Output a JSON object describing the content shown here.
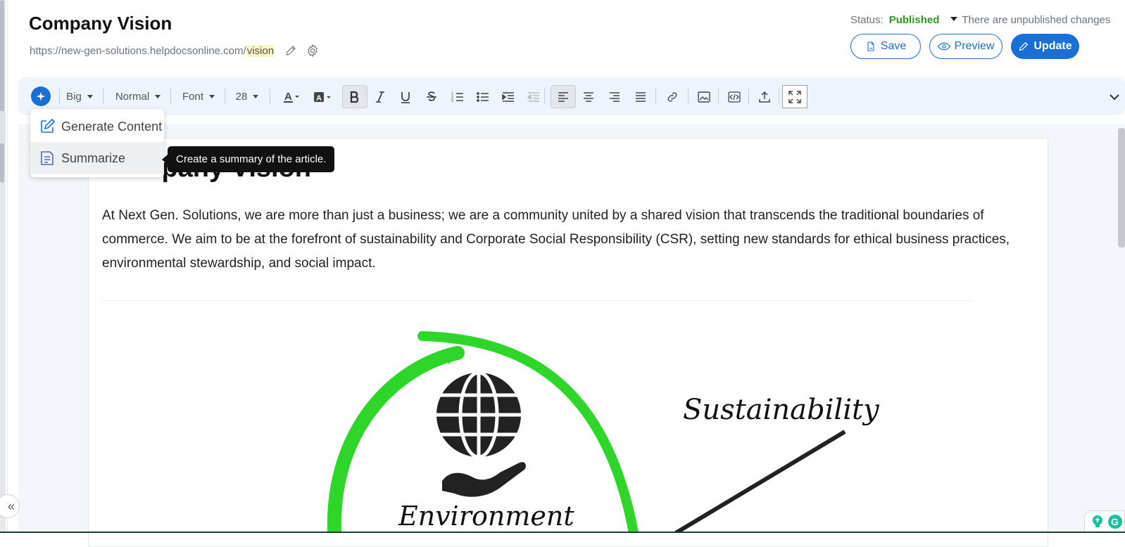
{
  "article": {
    "title": "Company Vision",
    "url_prefix": "https://new-gen-solutions.helpdocsonline.com/",
    "url_slug": "vision"
  },
  "status": {
    "label": "Status:",
    "value": "Published",
    "notice": "There are unpublished changes"
  },
  "actions": {
    "save": "Save",
    "preview": "Preview",
    "update": "Update"
  },
  "toolbar": {
    "heading_size": "Big",
    "paragraph_style": "Normal",
    "font": "Font",
    "font_size": "28"
  },
  "ai_menu": {
    "items": [
      {
        "label": "Generate Content",
        "icon": "edit-icon"
      },
      {
        "label": "Summarize",
        "icon": "document-icon"
      }
    ],
    "tooltip": "Create a summary of the article."
  },
  "content": {
    "heading": "Company Vision",
    "paragraph": "At Next Gen. Solutions, we are more than just a business; we are a community united by a shared vision that transcends the traditional boundaries of commerce. We aim to be at the forefront of sustainability and Corporate Social Responsibility (CSR), setting new standards for ethical business practices, environmental stewardship, and social impact.",
    "image_labels": {
      "sustainability": "Sustainability",
      "environment": "Environment"
    }
  },
  "colors": {
    "accent": "#1a6fd6",
    "published": "#2e9a1f",
    "toolbar_bg": "#eef4fc"
  }
}
